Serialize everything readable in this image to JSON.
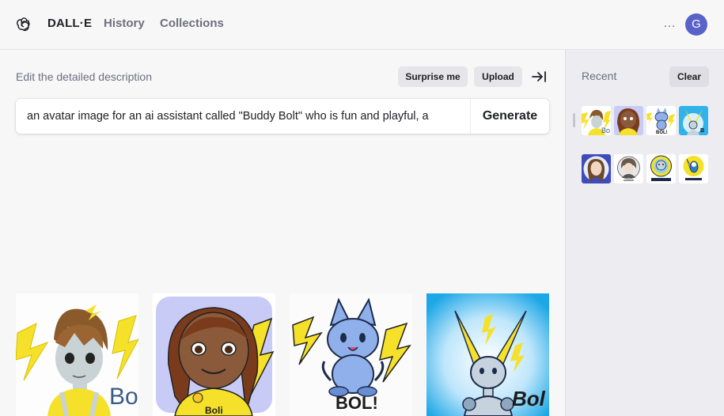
{
  "header": {
    "brand": "DALL·E",
    "nav": [
      {
        "label": "History"
      },
      {
        "label": "Collections"
      }
    ],
    "more_icon": "…",
    "avatar_initial": "G",
    "avatar_color": "#5862c9"
  },
  "prompt": {
    "label": "Edit the detailed description",
    "surprise_label": "Surprise me",
    "upload_label": "Upload",
    "value": "an avatar image for an ai assistant called \"Buddy Bolt\" who is fun and playful, a",
    "generate_label": "Generate"
  },
  "sidebar": {
    "title": "Recent",
    "clear_label": "Clear"
  },
  "results": [
    {
      "caption": "Bot",
      "icon": "lightning-boy-image"
    },
    {
      "caption": "Boli",
      "icon": "girl-lightning-image"
    },
    {
      "caption": "BOL!",
      "icon": "blue-cat-image"
    },
    {
      "caption": "Bol",
      "icon": "robot-lightning-image"
    }
  ],
  "colors": {
    "background": "#f7f7f8",
    "sidebar": "#ececf1",
    "bolt": "#f5e02a"
  }
}
